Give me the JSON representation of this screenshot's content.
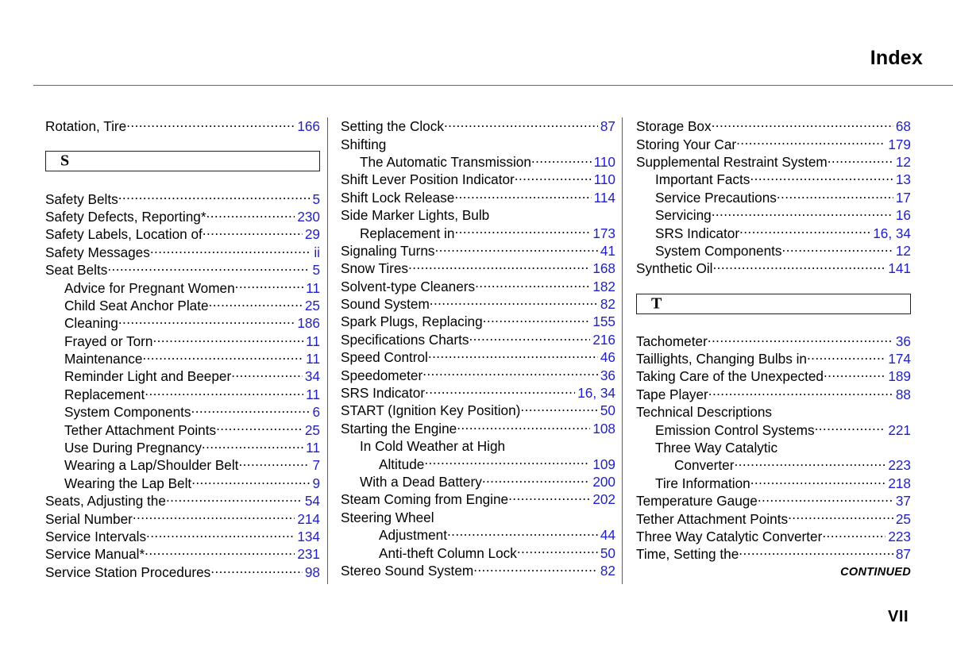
{
  "header": {
    "title": "Index"
  },
  "footer": {
    "continued": "CONTINUED",
    "folio": "VII"
  },
  "columns": [
    {
      "id": "column-left",
      "blocks": [
        {
          "type": "entry",
          "indent": 0,
          "label": "Rotation, Tire",
          "page": "166"
        },
        {
          "type": "spacer",
          "size": "sm"
        },
        {
          "type": "letterbox",
          "letter": "S"
        },
        {
          "type": "spacer",
          "size": "sm"
        },
        {
          "type": "entry",
          "indent": 0,
          "label": "Safety Belts",
          "page": "5"
        },
        {
          "type": "entry",
          "indent": 0,
          "label": "Safety Defects, Reporting*",
          "page": "230"
        },
        {
          "type": "entry",
          "indent": 0,
          "label": "Safety Labels, Location of",
          "page": "29"
        },
        {
          "type": "entry",
          "indent": 0,
          "label": "Safety Messages",
          "page": "ii"
        },
        {
          "type": "entry",
          "indent": 0,
          "label": "Seat Belts",
          "page": "5"
        },
        {
          "type": "entry",
          "indent": 1,
          "label": "Advice for Pregnant Women",
          "page": "11"
        },
        {
          "type": "entry",
          "indent": 1,
          "label": "Child Seat Anchor Plate",
          "page": "25"
        },
        {
          "type": "entry",
          "indent": 1,
          "label": "Cleaning",
          "page": "186"
        },
        {
          "type": "entry",
          "indent": 1,
          "label": "Frayed or Torn",
          "page": "11"
        },
        {
          "type": "entry",
          "indent": 1,
          "label": "Maintenance",
          "page": "11"
        },
        {
          "type": "entry",
          "indent": 1,
          "label": "Reminder Light and Beeper",
          "page": "34"
        },
        {
          "type": "entry",
          "indent": 1,
          "label": "Replacement",
          "page": "11"
        },
        {
          "type": "entry",
          "indent": 1,
          "label": "System Components",
          "page": "6"
        },
        {
          "type": "entry",
          "indent": 1,
          "label": "Tether Attachment Points",
          "page": "25"
        },
        {
          "type": "entry",
          "indent": 1,
          "label": "Use During Pregnancy",
          "page": "11"
        },
        {
          "type": "entry",
          "indent": 1,
          "label": "Wearing a Lap/Shoulder Belt",
          "page": "7"
        },
        {
          "type": "entry",
          "indent": 1,
          "label": "Wearing the Lap Belt",
          "page": "9"
        },
        {
          "type": "entry",
          "indent": 0,
          "label": "Seats, Adjusting the",
          "page": "54"
        },
        {
          "type": "entry",
          "indent": 0,
          "label": "Serial Number",
          "page": "214"
        },
        {
          "type": "entry",
          "indent": 0,
          "label": "Service Intervals",
          "page": "134"
        },
        {
          "type": "entry",
          "indent": 0,
          "label": "Service Manual*",
          "page": "231"
        },
        {
          "type": "entry",
          "indent": 0,
          "label": "Service Station Procedures ",
          "page": "98"
        }
      ]
    },
    {
      "id": "column-middle",
      "blocks": [
        {
          "type": "entry",
          "indent": 0,
          "label": "Setting the Clock",
          "page": "87"
        },
        {
          "type": "entry",
          "indent": 0,
          "label": "Shifting",
          "page": "",
          "dots": false
        },
        {
          "type": "entry",
          "indent": 1,
          "label": "The Automatic Transmission ",
          "page": "110"
        },
        {
          "type": "entry",
          "indent": 0,
          "label": "Shift Lever Position Indicator",
          "page": "110"
        },
        {
          "type": "entry",
          "indent": 0,
          "label": "Shift Lock Release",
          "page": "114"
        },
        {
          "type": "entry",
          "indent": 0,
          "label": "Side Marker Lights, Bulb",
          "page": "",
          "dots": false
        },
        {
          "type": "entry",
          "indent": 1,
          "label": "Replacement in",
          "page": "173"
        },
        {
          "type": "entry",
          "indent": 0,
          "label": "Signaling Turns",
          "page": "41"
        },
        {
          "type": "entry",
          "indent": 0,
          "label": "Snow Tires",
          "page": "168"
        },
        {
          "type": "entry",
          "indent": 0,
          "label": "Solvent-type Cleaners",
          "page": "182"
        },
        {
          "type": "entry",
          "indent": 0,
          "label": "Sound System",
          "page": "82"
        },
        {
          "type": "entry",
          "indent": 0,
          "label": "Spark Plugs, Replacing",
          "page": "155"
        },
        {
          "type": "entry",
          "indent": 0,
          "label": "Specifications Charts",
          "page": "216"
        },
        {
          "type": "entry",
          "indent": 0,
          "label": "Speed Control",
          "page": "46"
        },
        {
          "type": "entry",
          "indent": 0,
          "label": "Speedometer",
          "page": "36"
        },
        {
          "type": "entry",
          "indent": 0,
          "label": "SRS Indicator",
          "page": "16, 34"
        },
        {
          "type": "entry",
          "indent": 0,
          "label": "START (Ignition Key Position)",
          "page": "50"
        },
        {
          "type": "entry",
          "indent": 0,
          "label": "Starting the Engine",
          "page": "108"
        },
        {
          "type": "entry",
          "indent": 1,
          "label": "In Cold Weather at High",
          "page": "",
          "dots": false
        },
        {
          "type": "entry",
          "indent": 2,
          "label": "Altitude",
          "page": "109"
        },
        {
          "type": "entry",
          "indent": 1,
          "label": "With a Dead Battery ",
          "page": "200"
        },
        {
          "type": "entry",
          "indent": 0,
          "label": "Steam Coming from Engine",
          "page": "202"
        },
        {
          "type": "entry",
          "indent": 0,
          "label": "Steering Wheel",
          "page": "",
          "dots": false
        },
        {
          "type": "entry",
          "indent": 2,
          "label": "Adjustment",
          "page": "44"
        },
        {
          "type": "entry",
          "indent": 2,
          "label": "Anti-theft Column Lock",
          "page": "50"
        },
        {
          "type": "entry",
          "indent": 0,
          "label": "Stereo Sound System ",
          "page": "82"
        }
      ]
    },
    {
      "id": "column-right",
      "blocks": [
        {
          "type": "entry",
          "indent": 0,
          "label": "Storage Box",
          "page": "68"
        },
        {
          "type": "entry",
          "indent": 0,
          "label": "Storing Your Car",
          "page": "179"
        },
        {
          "type": "entry",
          "indent": 0,
          "label": "Supplemental Restraint System",
          "page": "12"
        },
        {
          "type": "entry",
          "indent": 1,
          "label": "Important Facts",
          "page": "13"
        },
        {
          "type": "entry",
          "indent": 1,
          "label": "Service Precautions",
          "page": "17"
        },
        {
          "type": "entry",
          "indent": 1,
          "label": "Servicing",
          "page": "16"
        },
        {
          "type": "entry",
          "indent": 1,
          "label": "SRS Indicator",
          "page": "16, 34"
        },
        {
          "type": "entry",
          "indent": 1,
          "label": "System Components",
          "page": "12"
        },
        {
          "type": "entry",
          "indent": 0,
          "label": "Synthetic Oil",
          "page": "141"
        },
        {
          "type": "spacer",
          "size": "sm"
        },
        {
          "type": "letterbox",
          "letter": "T"
        },
        {
          "type": "spacer",
          "size": "sm"
        },
        {
          "type": "entry",
          "indent": 0,
          "label": "Tachometer",
          "page": "36"
        },
        {
          "type": "entry",
          "indent": 0,
          "label": "Taillights, Changing Bulbs in",
          "page": "174"
        },
        {
          "type": "entry",
          "indent": 0,
          "label": "Taking Care of the Unexpected ",
          "page": "189"
        },
        {
          "type": "entry",
          "indent": 0,
          "label": "Tape Player",
          "page": "88"
        },
        {
          "type": "entry",
          "indent": 0,
          "label": "Technical Descriptions",
          "page": "",
          "dots": false
        },
        {
          "type": "entry",
          "indent": 1,
          "label": "Emission Control Systems",
          "page": "221"
        },
        {
          "type": "entry",
          "indent": 1,
          "label": "Three Way Catalytic",
          "page": "",
          "dots": false
        },
        {
          "type": "entry",
          "indent": 2,
          "label": "Converter",
          "page": "223"
        },
        {
          "type": "entry",
          "indent": 1,
          "label": "Tire Information",
          "page": "218"
        },
        {
          "type": "entry",
          "indent": 0,
          "label": "Temperature Gauge",
          "page": "37"
        },
        {
          "type": "entry",
          "indent": 0,
          "label": "Tether Attachment Points",
          "page": "25"
        },
        {
          "type": "entry",
          "indent": 0,
          "label": "Three Way Catalytic Converter",
          "page": "223"
        },
        {
          "type": "entry",
          "indent": 0,
          "label": "Time, Setting the ",
          "page": "87"
        }
      ]
    }
  ],
  "colors": {
    "page_number": "#2020c8",
    "text": "#000000",
    "rule": "#6a6a6a",
    "background": "#ffffff"
  }
}
